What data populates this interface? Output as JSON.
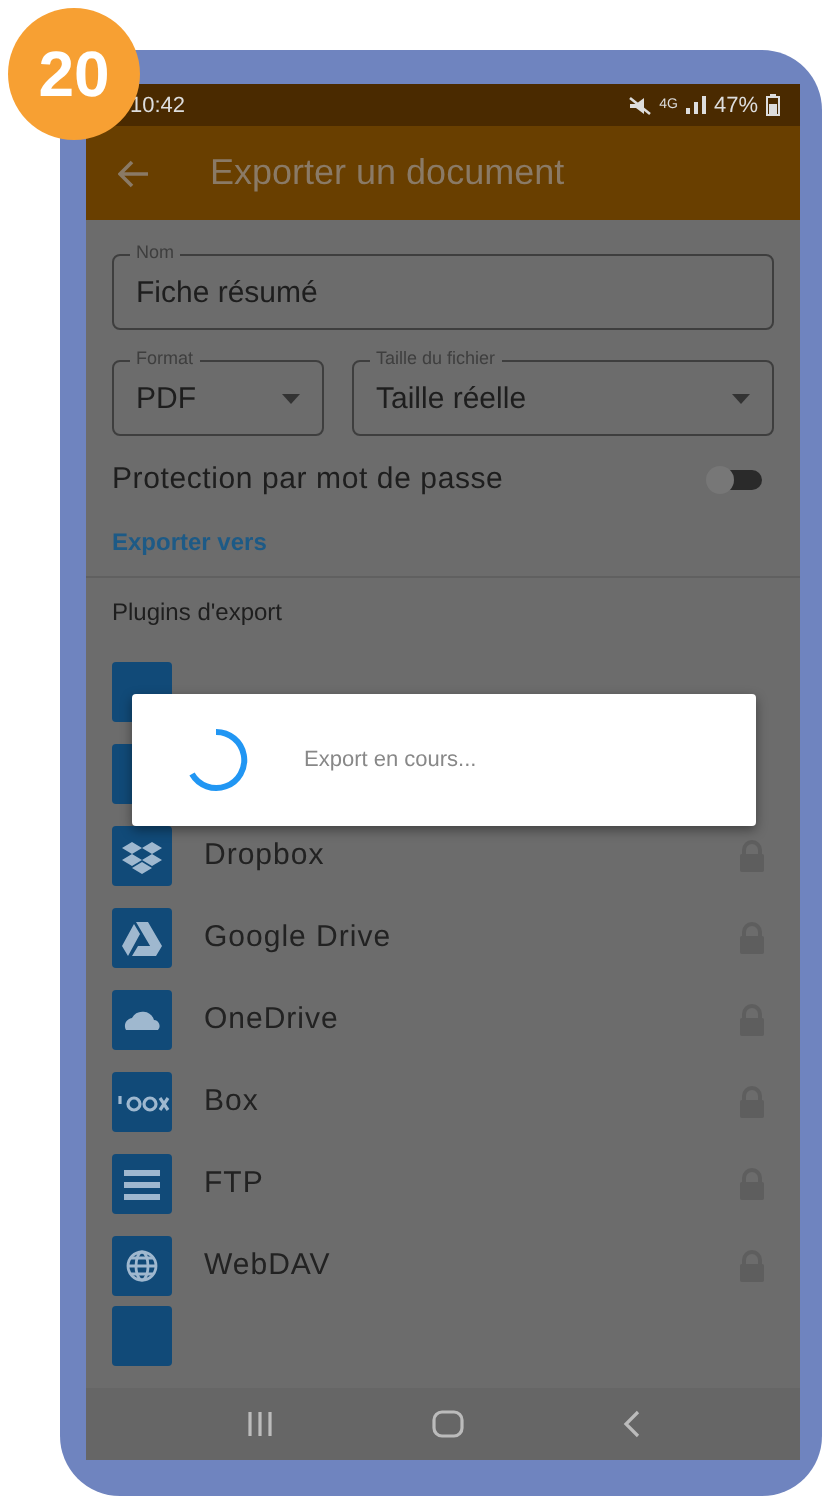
{
  "badge": "20",
  "status_bar": {
    "time": "10:42",
    "network": "4G",
    "battery": "47%"
  },
  "app_bar": {
    "title": "Exporter un document"
  },
  "name_field": {
    "label": "Nom",
    "value": "Fiche résumé"
  },
  "format_field": {
    "label": "Format",
    "value": "PDF"
  },
  "size_field": {
    "label": "Taille du fichier",
    "value": "Taille réelle"
  },
  "password_protection": {
    "label": "Protection par mot de passe",
    "on": false
  },
  "export_to_link": "Exporter vers",
  "plugins": {
    "title": "Plugins d'export",
    "items": [
      {
        "kind": "dropbox",
        "label": "Dropbox",
        "locked": true
      },
      {
        "kind": "drive",
        "label": "Google Drive",
        "locked": true
      },
      {
        "kind": "cloud",
        "label": "OneDrive",
        "locked": true
      },
      {
        "kind": "box",
        "label": "Box",
        "locked": true
      },
      {
        "kind": "ftp",
        "label": "FTP",
        "locked": true
      },
      {
        "kind": "globe",
        "label": "WebDAV",
        "locked": true
      }
    ]
  },
  "dialog": {
    "message": "Export en cours..."
  }
}
